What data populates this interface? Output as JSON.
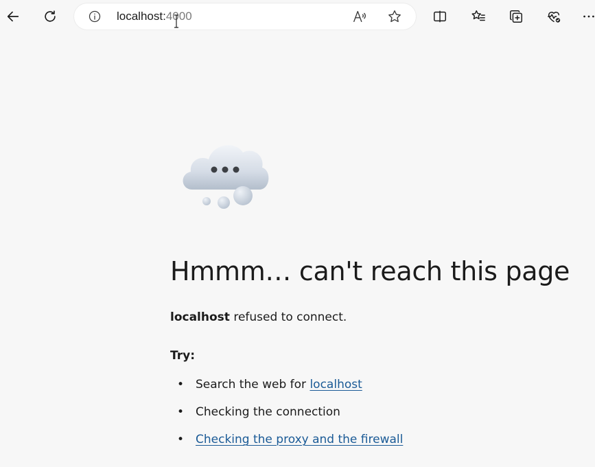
{
  "browser": {
    "url_host": "localhost:",
    "url_port": "4000",
    "icons": {
      "back": "back-arrow-icon",
      "refresh": "refresh-icon",
      "info": "info-icon",
      "read_aloud": "read-aloud-icon",
      "favorite": "favorite-star-icon",
      "split_screen": "split-screen-icon",
      "favorites": "favorites-list-icon",
      "collections": "collections-icon",
      "performance": "browser-essentials-icon",
      "more": "more-icon"
    }
  },
  "error_page": {
    "heading": "Hmmm… can't reach this page",
    "subtitle_host": "localhost",
    "subtitle_rest": " refused to connect.",
    "try_label": "Try:",
    "bullet": "•",
    "suggestions": [
      {
        "prefix": "Search the web for ",
        "link": "localhost"
      },
      {
        "text": "Checking the connection"
      },
      {
        "link": "Checking the proxy and the firewall"
      }
    ]
  },
  "colors": {
    "link": "#1a5a96",
    "background": "#f7f7f7"
  }
}
